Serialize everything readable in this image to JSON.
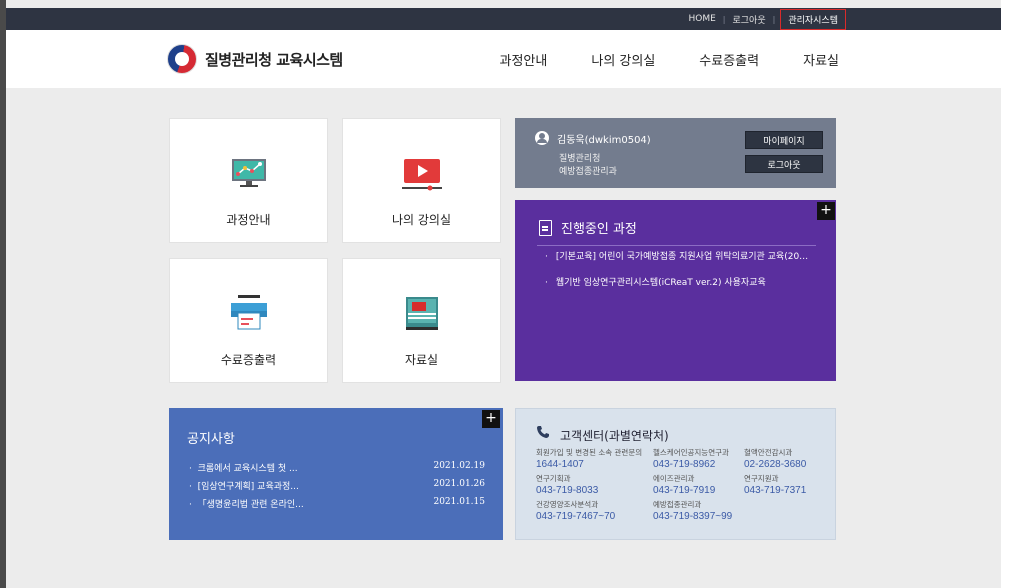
{
  "topbar": {
    "home": "HOME",
    "logout": "로그아웃",
    "admin": "관리자시스템"
  },
  "header": {
    "logo_text": "질병관리청 교육시스템",
    "nav": [
      "과정안내",
      "나의 강의실",
      "수료증출력",
      "자료실"
    ]
  },
  "tiles": [
    {
      "label": "과정안내",
      "icon": "monitor-chart-icon"
    },
    {
      "label": "나의 강의실",
      "icon": "video-play-icon"
    },
    {
      "label": "수료증출력",
      "icon": "printer-icon"
    },
    {
      "label": "자료실",
      "icon": "folder-book-icon"
    }
  ],
  "profile": {
    "name": "김동욱(dwkim0504)",
    "org": "질병관리청",
    "dept": "예방접종관리과",
    "mypage_btn": "마이페이지",
    "logout_btn": "로그아웃"
  },
  "courses": {
    "title": "진행중인 과정",
    "items": [
      "[기본교육] 어린이 국가예방접종 지원사업 위탁의료기관 교육(20…",
      "웹기반 임상연구관리시스템(iCReaT ver.2) 사용자교육"
    ],
    "plus": "+"
  },
  "notice": {
    "title": "공지사항",
    "plus": "+",
    "bullet": "·",
    "items": [
      {
        "title": "크롬에서 교육시스템 첫 ...",
        "date": "2021.02.19"
      },
      {
        "title": "[임상연구계획] 교육과정...",
        "date": "2021.01.26"
      },
      {
        "title": "「생명윤리법 관련 온라인...",
        "date": "2021.01.15"
      }
    ]
  },
  "contact": {
    "title": "고객센터(과별연락처)",
    "entries": [
      {
        "label": "회원가입 및 변경된 소속 관련문의",
        "number": "1644-1407"
      },
      {
        "label": "헬스케어인공지능연구과",
        "number": "043-719-8962"
      },
      {
        "label": "혈액안전감시과",
        "number": "02-2628-3680"
      },
      {
        "label": "연구기획과",
        "number": "043-719-8033"
      },
      {
        "label": "에이즈관리과",
        "number": "043-719-7919"
      },
      {
        "label": "연구지원과",
        "number": "043-719-7371"
      },
      {
        "label": "건강영양조사분석과",
        "number": "043-719-7467~70"
      },
      {
        "label": "예방접종관리과",
        "number": "043-719-8397~99"
      }
    ]
  }
}
